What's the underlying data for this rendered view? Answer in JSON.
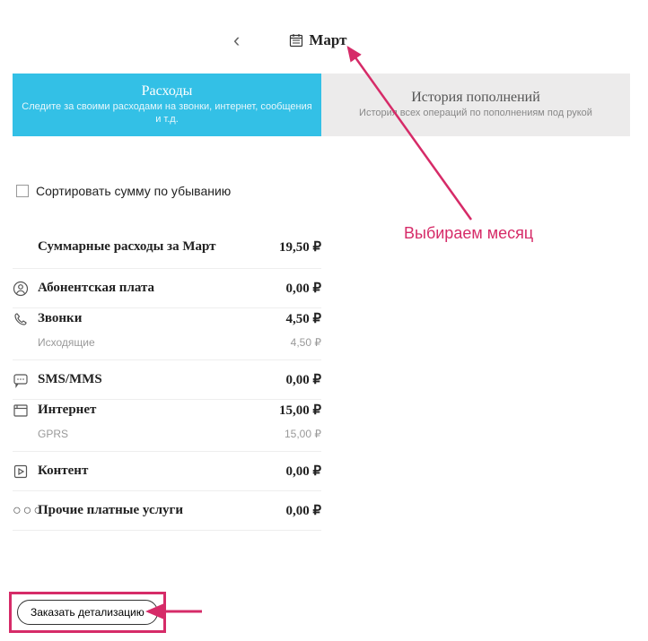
{
  "month_picker": {
    "month": "Март"
  },
  "tabs": {
    "expenses": {
      "title": "Расходы",
      "subtitle": "Следите за своими расходами на звонки, интернет, сообщения и т.д."
    },
    "history": {
      "title": "История пополнений",
      "subtitle": "История всех операций по пополнениям под рукой"
    }
  },
  "sort": {
    "label": "Сортировать сумму по убыванию"
  },
  "rows": {
    "total": {
      "label": "Суммарные расходы за Март",
      "value": "19,50 ₽"
    },
    "subscription": {
      "label": "Абонентская плата",
      "value": "0,00 ₽"
    },
    "calls": {
      "label": "Звонки",
      "value": "4,50 ₽",
      "sub_label": "Исходящие",
      "sub_value": "4,50 ₽"
    },
    "sms": {
      "label": "SMS/MMS",
      "value": "0,00 ₽"
    },
    "internet": {
      "label": "Интернет",
      "value": "15,00 ₽",
      "sub_label": "GPRS",
      "sub_value": "15,00 ₽"
    },
    "content": {
      "label": "Контент",
      "value": "0,00 ₽"
    },
    "other": {
      "label": "Прочие платные услуги",
      "value": "0,00 ₽"
    }
  },
  "order_button": "Заказать детализацию",
  "annotation": {
    "label": "Выбираем месяц"
  }
}
